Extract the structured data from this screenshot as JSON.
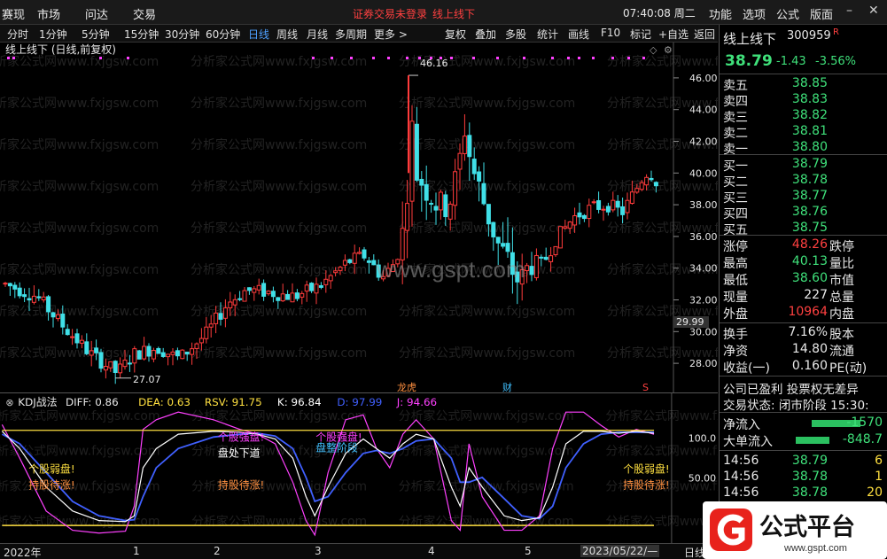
{
  "menu": {
    "items": [
      "赛现",
      "市场",
      "问达",
      "交易"
    ],
    "notice": "证券交易未登录",
    "formula_name": "线上线下",
    "clock": "07:40:08 周二",
    "right_items": [
      "功能",
      "选项",
      "公式",
      "版面"
    ]
  },
  "toolbar": {
    "periods": [
      "分时",
      "1分钟",
      "5分钟",
      "15分钟",
      "30分钟",
      "60分钟",
      "日线",
      "周线",
      "月线",
      "多周期",
      "更多 >"
    ],
    "actions": [
      "复权",
      "叠加",
      "多股",
      "统计",
      "画线",
      "F10",
      "标记",
      "+自选",
      "返回"
    ]
  },
  "main": {
    "title": "线上线下 (日线,前复权)",
    "watermarks": [
      "分析家公式网www.fxjgsw.com"
    ],
    "center_watermark": "www.gspt.com",
    "high_label": "46.16",
    "low_label": "27.07",
    "current_price_tag": "29.99",
    "event_labels": [
      "龙虎",
      "财",
      "S"
    ]
  },
  "indicator": {
    "title": "KDJ战法",
    "values": [
      {
        "name": "DIFF:",
        "value": "0.86",
        "color": "#e8e8e8"
      },
      {
        "name": "DEA:",
        "value": "0.63",
        "color": "#ffe040"
      },
      {
        "name": "RSV:",
        "value": "91.75",
        "color": "#ffe040"
      },
      {
        "name": "K:",
        "value": "96.84",
        "color": "#ffffff"
      },
      {
        "name": "D:",
        "value": "97.99",
        "color": "#4060ff"
      },
      {
        "name": "J:",
        "value": "94.66",
        "color": "#ff40ff"
      }
    ],
    "annotations": [
      {
        "text": "个股弱盘!",
        "color": "#ffe040"
      },
      {
        "text": "持股待涨!",
        "color": "#ff9040"
      },
      {
        "text": "个股强盘!",
        "color": "#ff40ff"
      },
      {
        "text": "盘处下道",
        "color": "#ffffff"
      },
      {
        "text": "持股待涨!",
        "color": "#ff9040"
      },
      {
        "text": "个股强盘!",
        "color": "#ff40ff"
      },
      {
        "text": "盘整阶段",
        "color": "#40c0ff"
      },
      {
        "text": "个股弱盘!",
        "color": "#ffe040"
      },
      {
        "text": "持股待涨!",
        "color": "#ff9040"
      }
    ],
    "yticks": [
      "100.0",
      "50.00"
    ]
  },
  "axis": {
    "labels": [
      "2022年",
      "1",
      "2",
      "3",
      "4",
      "5",
      "2023/05/22/—",
      "日线"
    ]
  },
  "quote": {
    "name": "线上线下",
    "code": "300959",
    "flag": "R",
    "price": "38.79",
    "change": "-1.43",
    "change_pct": "-3.56%",
    "asks": [
      {
        "label": "卖五",
        "price": "38.85"
      },
      {
        "label": "卖四",
        "price": "38.83"
      },
      {
        "label": "卖三",
        "price": "38.82"
      },
      {
        "label": "卖二",
        "price": "38.81"
      },
      {
        "label": "卖一",
        "price": "38.80"
      }
    ],
    "bids": [
      {
        "label": "买一",
        "price": "38.79"
      },
      {
        "label": "买二",
        "price": "38.78"
      },
      {
        "label": "买三",
        "price": "38.77"
      },
      {
        "label": "买四",
        "price": "38.76"
      },
      {
        "label": "买五",
        "price": "38.75"
      }
    ],
    "stats": [
      {
        "l1": "涨停",
        "v1": "48.26",
        "c1": "red",
        "l2": "跌停"
      },
      {
        "l1": "最高",
        "v1": "40.13",
        "c1": "green",
        "l2": "量比"
      },
      {
        "l1": "最低",
        "v1": "38.60",
        "c1": "green",
        "l2": "市值"
      },
      {
        "l1": "现量",
        "v1": "227",
        "c1": "plain",
        "l2": "总量"
      },
      {
        "l1": "外盘",
        "v1": "10964",
        "c1": "red",
        "l2": "内盘"
      }
    ],
    "stats2": [
      {
        "l1": "换手",
        "v1": "7.16%",
        "l2": "股本"
      },
      {
        "l1": "净资",
        "v1": "14.80",
        "l2": "流通"
      },
      {
        "l1": "收益(一)",
        "v1": "0.160",
        "l2": "PE(动)"
      }
    ],
    "info1": "公司已盈利 投票权无差异",
    "info2": "交易状态: 闭市阶段 15:30:",
    "flow": [
      {
        "label": "净流入",
        "value": "-1570"
      },
      {
        "label": "大单流入",
        "value": "-848.7"
      }
    ],
    "ticks": [
      {
        "time": "14:56",
        "price": "38.79",
        "vol": "6"
      },
      {
        "time": "14:56",
        "price": "38.78",
        "vol": "1"
      },
      {
        "time": "14:56",
        "price": "38.78",
        "vol": "20"
      }
    ]
  },
  "logo": {
    "text": "公式平台",
    "url": "www.gspt.com"
  },
  "chart_data": {
    "type": "candlestick",
    "ylim": [
      27,
      47
    ],
    "yticks": [
      28,
      30,
      32,
      34,
      36,
      38,
      40,
      42,
      44,
      46
    ],
    "annotations": {
      "high": 46.16,
      "low": 27.07,
      "last": 29.99
    }
  }
}
